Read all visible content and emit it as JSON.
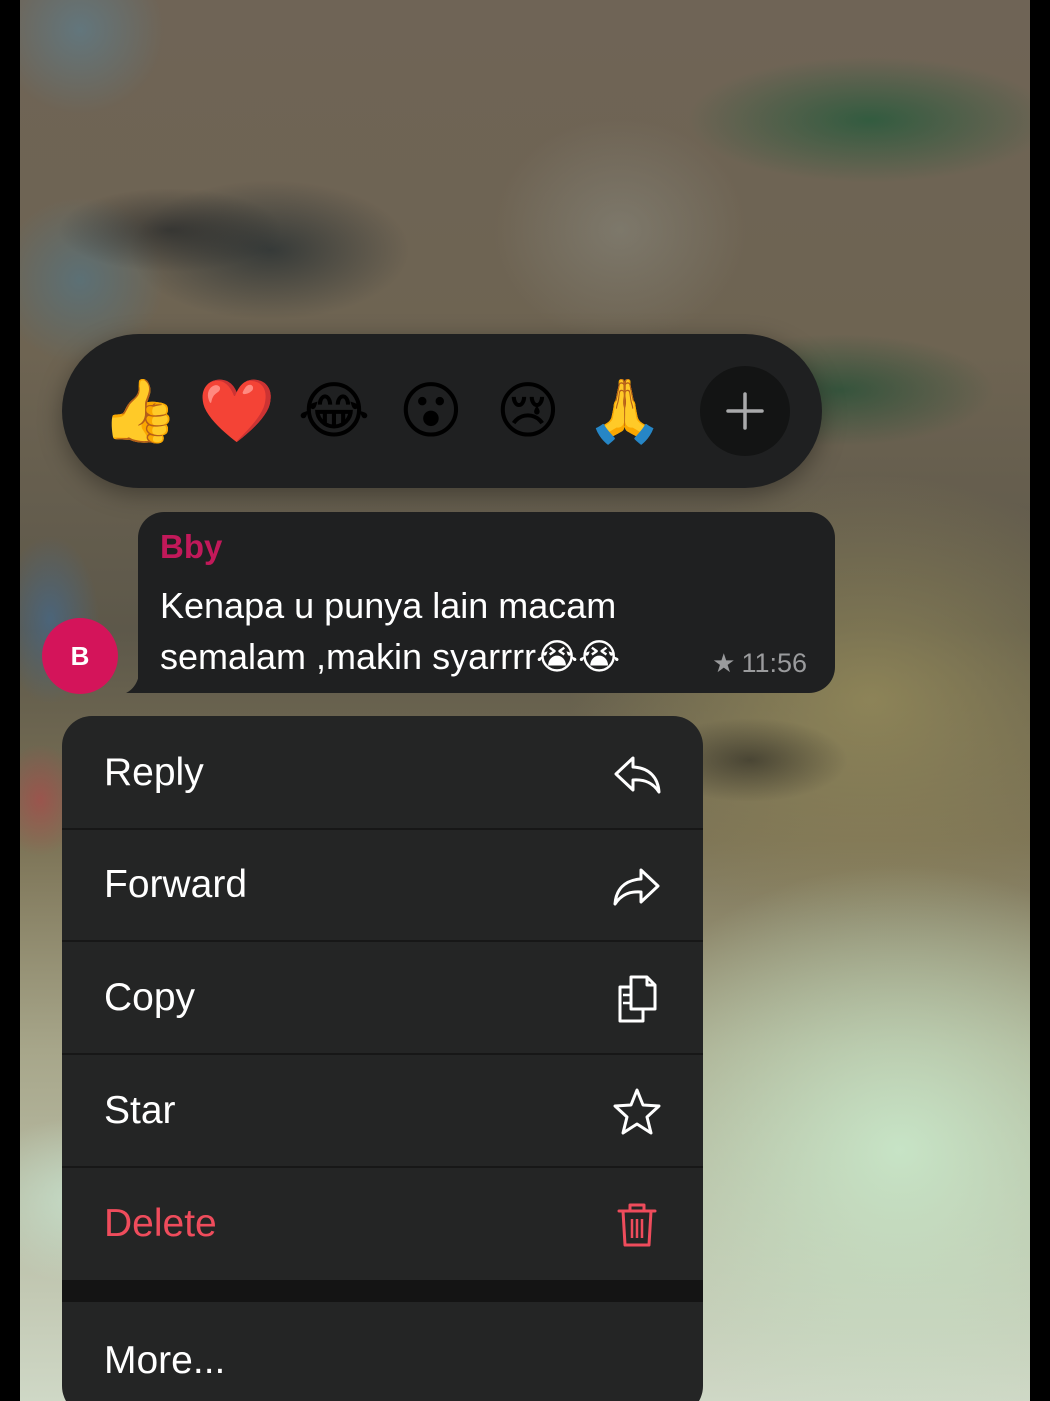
{
  "reactions": {
    "emojis": [
      "👍",
      "❤️",
      "😂",
      "😮",
      "😢",
      "🙏"
    ],
    "more_icon": "plus-icon"
  },
  "message": {
    "avatar_initial": "B",
    "sender": "Bby",
    "text": "Kenapa u punya lain macam\nsemalam ,makin syarrrr😭😭",
    "time": "11:56",
    "starred": true,
    "sender_color": "#c2195a",
    "avatar_color": "#d4145a"
  },
  "menu": {
    "items": [
      {
        "label": "Reply",
        "icon": "reply-icon"
      },
      {
        "label": "Forward",
        "icon": "forward-icon"
      },
      {
        "label": "Copy",
        "icon": "copy-icon"
      },
      {
        "label": "Star",
        "icon": "star-icon"
      },
      {
        "label": "Delete",
        "icon": "trash-icon",
        "color": "#ef4c5c"
      }
    ],
    "more_label": "More..."
  }
}
